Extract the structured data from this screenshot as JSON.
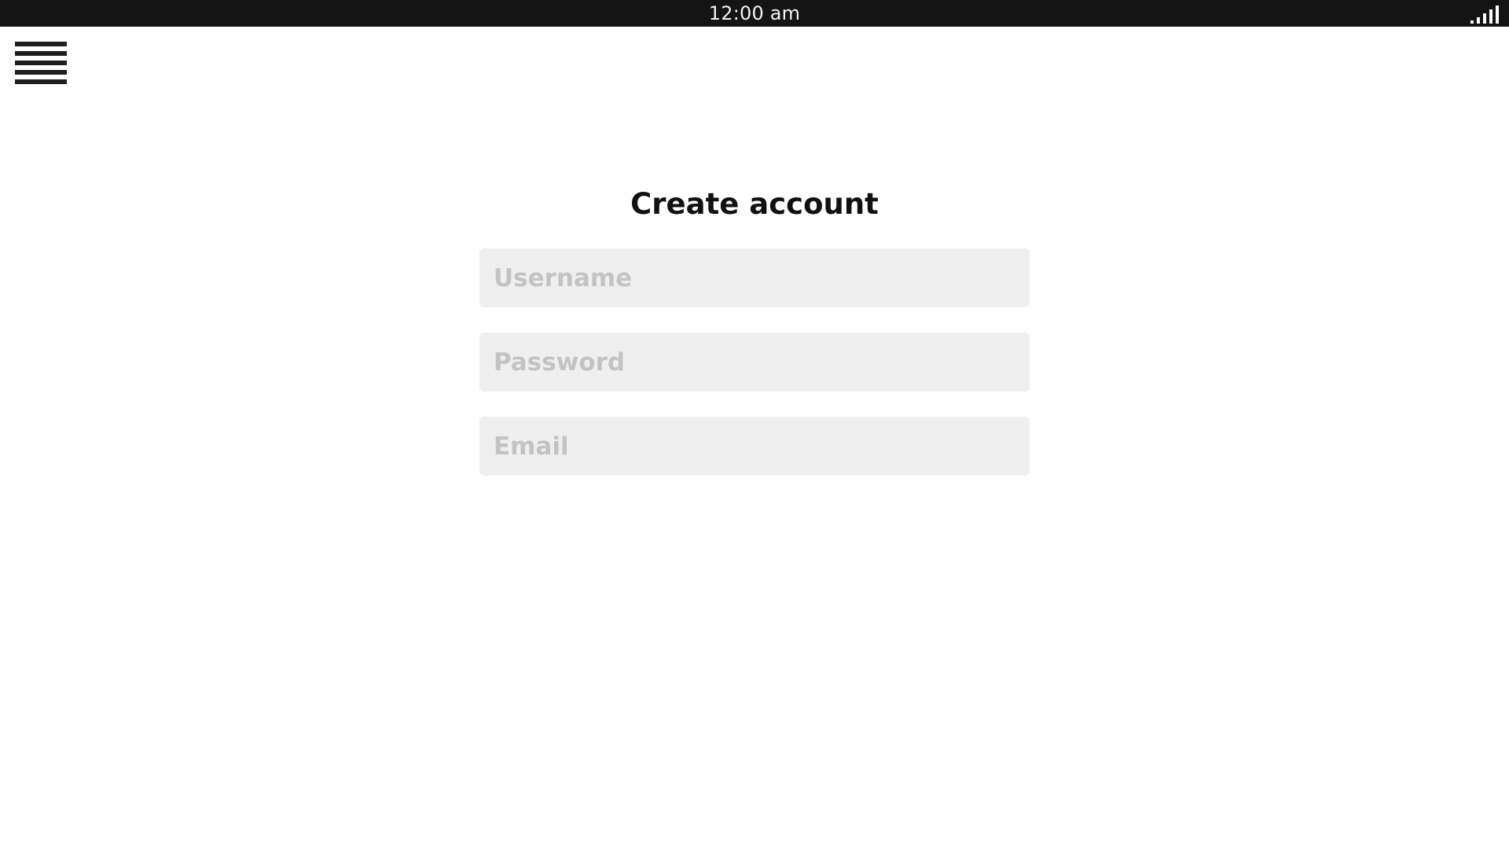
{
  "status_bar": {
    "time": "12:00 am",
    "signal_icon": "signal-strength-icon"
  },
  "header": {
    "menu_icon": "hamburger-menu-icon"
  },
  "form": {
    "title": "Create account",
    "username": {
      "value": "",
      "placeholder": "Username"
    },
    "password": {
      "value": "",
      "placeholder": "Password"
    },
    "email": {
      "value": "",
      "placeholder": "Email"
    }
  },
  "colors": {
    "status_bar_bg": "#141414",
    "field_bg": "#efefef",
    "placeholder": "#c3c3c3",
    "text": "#111111"
  }
}
